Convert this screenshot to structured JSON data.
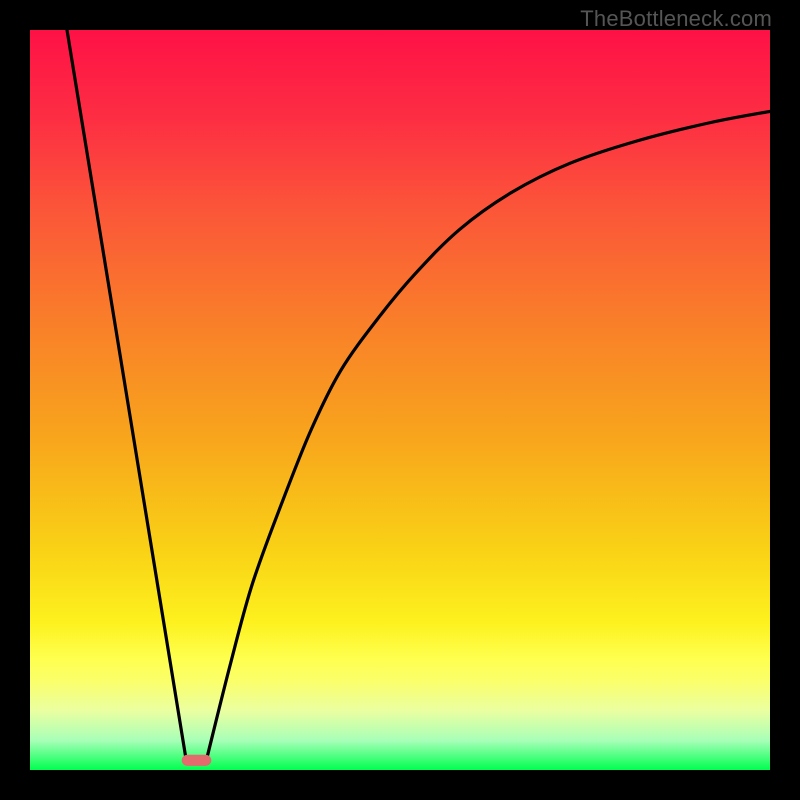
{
  "watermark": "TheBottleneck.com",
  "colors": {
    "frame": "#000000",
    "curve": "#000000",
    "marker_fill": "#e36a6d",
    "gradient_stops": [
      "#fe1146",
      "#fd2e43",
      "#fb5838",
      "#f98029",
      "#f8a51c",
      "#f9d116",
      "#fdf11e",
      "#feff4f",
      "#fbff6a",
      "#eaffa0",
      "#a8ffb8",
      "#00ff4f"
    ]
  },
  "chart_data": {
    "type": "line",
    "title": "",
    "xlabel": "",
    "ylabel": "",
    "xlim": [
      0,
      100
    ],
    "ylim": [
      0,
      100
    ],
    "annotations": [],
    "series": [
      {
        "name": "left-descending-line",
        "x": [
          5,
          21
        ],
        "y": [
          100,
          2
        ]
      },
      {
        "name": "right-ascending-curve",
        "x": [
          24,
          27,
          30,
          34,
          38,
          42,
          47,
          52,
          58,
          65,
          73,
          82,
          92,
          100
        ],
        "y": [
          2,
          14,
          25,
          36,
          46,
          54,
          61,
          67,
          73,
          78,
          82,
          85,
          87.5,
          89
        ]
      }
    ],
    "marker": {
      "name": "valley-pill",
      "x_center": 22.5,
      "y_center": 1.3,
      "width_frac": 0.04,
      "height_frac": 0.015
    }
  }
}
